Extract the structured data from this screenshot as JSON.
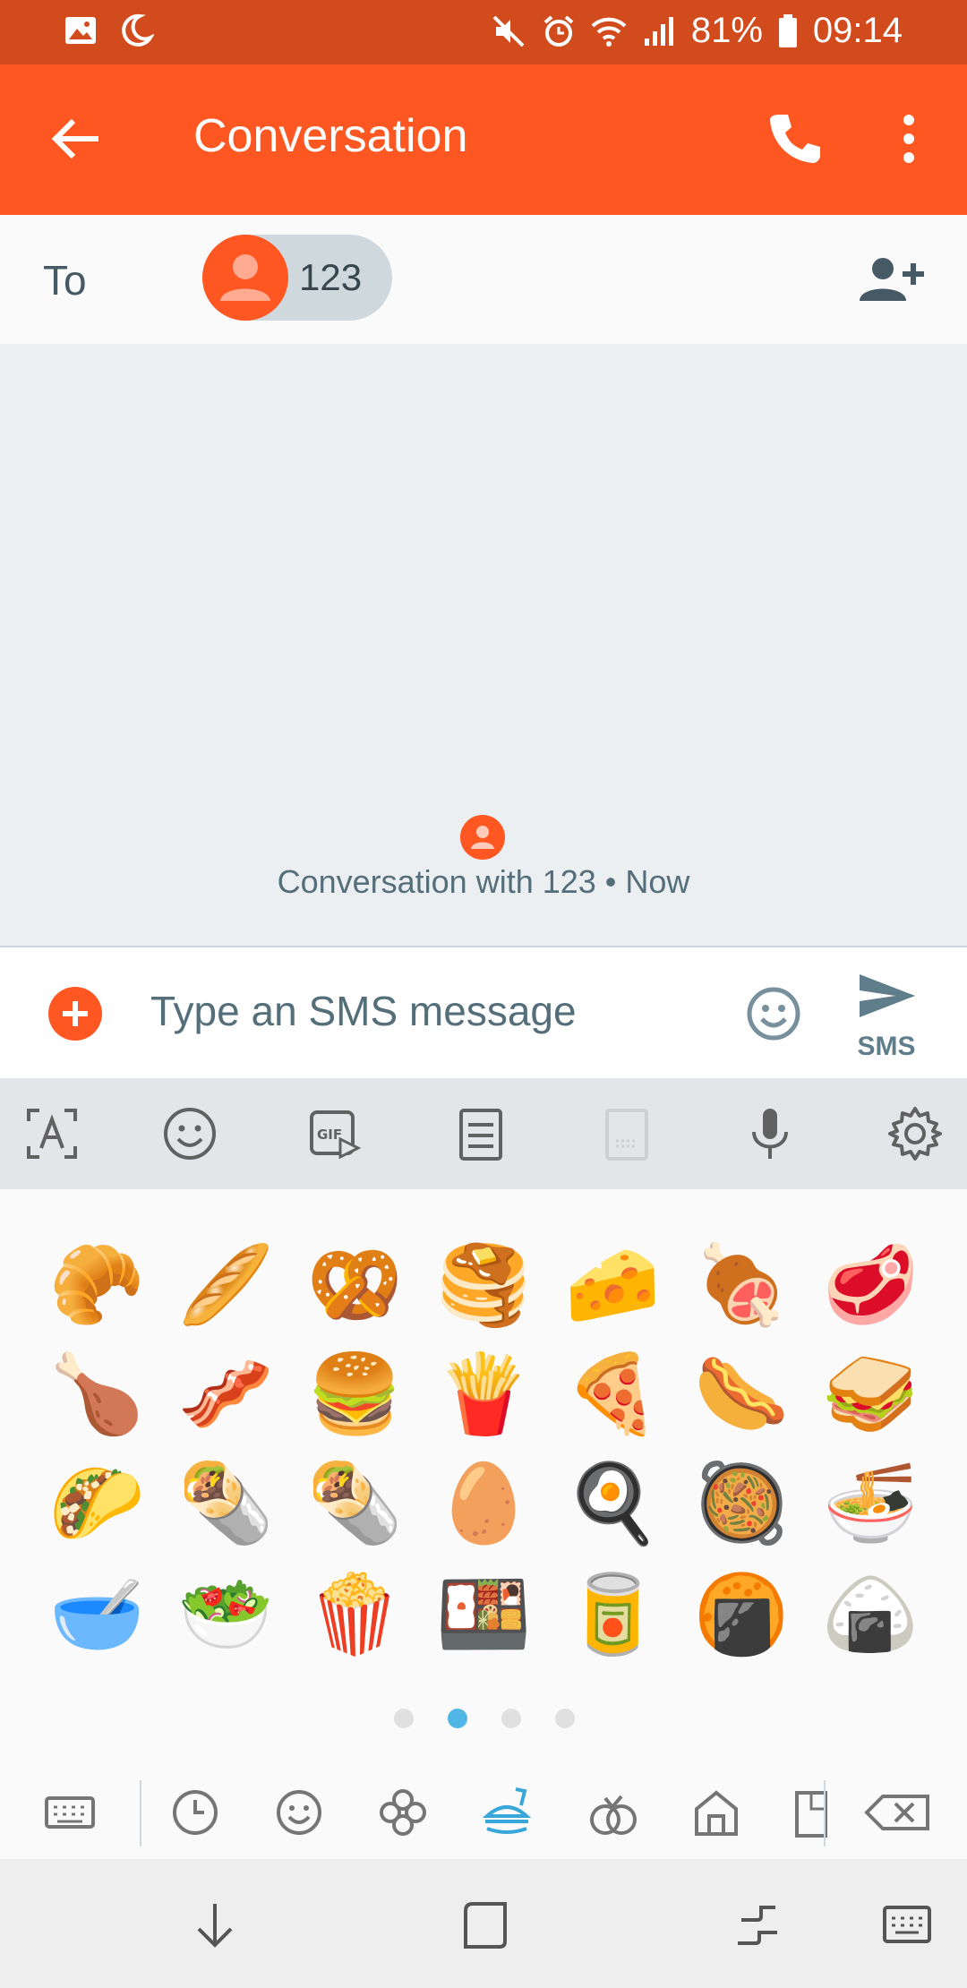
{
  "status_bar": {
    "battery": "81%",
    "time": "09:14"
  },
  "app_bar": {
    "title": "Conversation"
  },
  "recipient": {
    "to_label": "To",
    "chip_label": "123"
  },
  "conversation": {
    "meta": "Conversation with 123 • Now"
  },
  "compose": {
    "placeholder": "Type an SMS message",
    "send_label": "SMS"
  },
  "emoji_grid": [
    [
      "🥐",
      "🥖",
      "🥨",
      "🥞",
      "🧀",
      "🍖",
      "🥩"
    ],
    [
      "🍗",
      "🥓",
      "🍔",
      "🍟",
      "🍕",
      "🌭",
      "🥪"
    ],
    [
      "🌮",
      "🌯",
      "🌯",
      "🥚",
      "🍳",
      "🥘",
      "🍜"
    ],
    [
      "🥣",
      "🥗",
      "🍿",
      "🍱",
      "🥫",
      "🍘",
      "🍙"
    ]
  ],
  "emoji_pages": {
    "count": 4,
    "active": 1
  },
  "colors": {
    "accent": "#ff5722",
    "status_bar": "#d24b1d",
    "page_indicator_active": "#4fb6e6"
  }
}
